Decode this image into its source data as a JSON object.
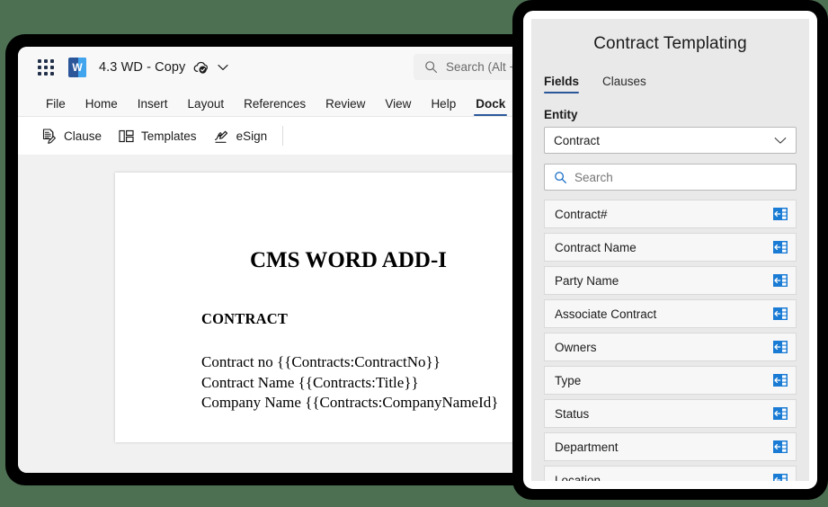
{
  "background_color": "#4d7053",
  "accent_color": "#2b579a",
  "word_window": {
    "titlebar": {
      "app_launcher_icon": "waffle-grid-icon",
      "app_logo_icon": "word-logo-icon",
      "document_title": "4.3 WD - Copy",
      "saved_status_icon": "cloud-saved-icon",
      "title_menu_icon": "chevron-down-icon",
      "search": {
        "icon": "search-icon",
        "placeholder": "Search (Alt + "
      }
    },
    "ribbon_tabs": [
      {
        "label": "File",
        "active": false
      },
      {
        "label": "Home",
        "active": false
      },
      {
        "label": "Insert",
        "active": false
      },
      {
        "label": "Layout",
        "active": false
      },
      {
        "label": "References",
        "active": false
      },
      {
        "label": "Review",
        "active": false
      },
      {
        "label": "View",
        "active": false
      },
      {
        "label": "Help",
        "active": false
      },
      {
        "label": "Dock",
        "active": true
      }
    ],
    "ribbon_commands": [
      {
        "label": "Clause",
        "icon": "clause-document-pen-icon"
      },
      {
        "label": "Templates",
        "icon": "templates-layout-icon"
      },
      {
        "label": "eSign",
        "icon": "esign-signature-pen-icon"
      }
    ],
    "document": {
      "heading": "CMS WORD ADD-I",
      "subheading": "CONTRACT",
      "lines": [
        "Contract no {{Contracts:ContractNo}}",
        "Contract Name {{Contracts:Title}}",
        "Company Name {{Contracts:CompanyNameId}"
      ]
    }
  },
  "addin_panel": {
    "title": "Contract Templating",
    "tabs": [
      {
        "label": "Fields",
        "active": true
      },
      {
        "label": "Clauses",
        "active": false
      }
    ],
    "entity": {
      "label": "Entity",
      "selected": "Contract",
      "chevron_icon": "chevron-down-icon"
    },
    "search": {
      "icon": "search-icon",
      "placeholder": "Search",
      "value": ""
    },
    "fields": [
      {
        "name": "Contract#",
        "action_icon": "insert-merge-field-icon"
      },
      {
        "name": "Contract Name",
        "action_icon": "insert-merge-field-icon"
      },
      {
        "name": "Party Name",
        "action_icon": "insert-merge-field-icon"
      },
      {
        "name": "Associate Contract",
        "action_icon": "insert-merge-field-icon"
      },
      {
        "name": "Owners",
        "action_icon": "insert-merge-field-icon"
      },
      {
        "name": "Type",
        "action_icon": "insert-merge-field-icon"
      },
      {
        "name": "Status",
        "action_icon": "insert-merge-field-icon"
      },
      {
        "name": "Department",
        "action_icon": "insert-merge-field-icon"
      },
      {
        "name": "Location",
        "action_icon": "insert-merge-field-icon"
      }
    ]
  }
}
